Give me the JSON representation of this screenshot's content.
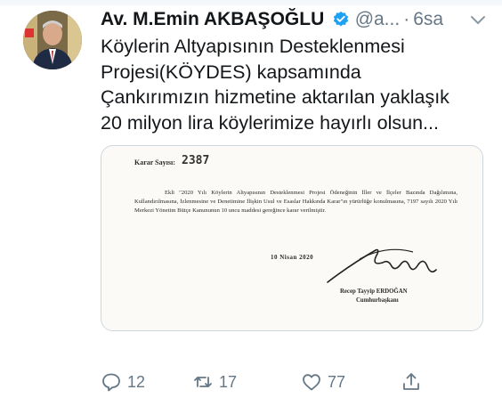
{
  "tweet": {
    "author_name": "Av. M.Emin AKBAŞOĞLU",
    "handle": "@a...",
    "separator": "·",
    "time": "6sa",
    "text": "Köylerin Altyapısının Desteklenmesi\nProjesi(KÖYDES) kapsamında\nÇankırımızın hizmetine aktarılan yaklaşık\n20 milyon lira köylerimize hayırlı olsun..."
  },
  "document": {
    "karar_label": "Karar Sayısı:",
    "karar_no": "2387",
    "body": "Ekli \"2020 Yılı Köylerin Altyapısının Desteklenmesi Projesi Ödeneğinin İller ve İlçeler Bazında Dağılımına, Kullandırılmasına, İzlenmesine ve Denetimine İlişkin Usul ve Esaslar Hakkında Karar\"ın yürürlüğe konulmasına, 7197 sayılı 2020 Yılı Merkezi Yönetim Bütçe Kanununun 10 uncu maddesi gereğince karar verilmiştir.",
    "date": "10 Nisan 2020",
    "signer": "Recep Tayyip ERDOĞAN",
    "signer_title": "Cumhurbaşkanı"
  },
  "actions": {
    "reply_count": "12",
    "retweet_count": "17",
    "like_count": "77"
  },
  "colors": {
    "verified": "#1da1f2",
    "muted": "#657786",
    "text": "#14171a"
  },
  "icons": [
    "verified-badge-icon",
    "chevron-down-icon",
    "reply-icon",
    "retweet-icon",
    "like-icon",
    "share-icon"
  ]
}
